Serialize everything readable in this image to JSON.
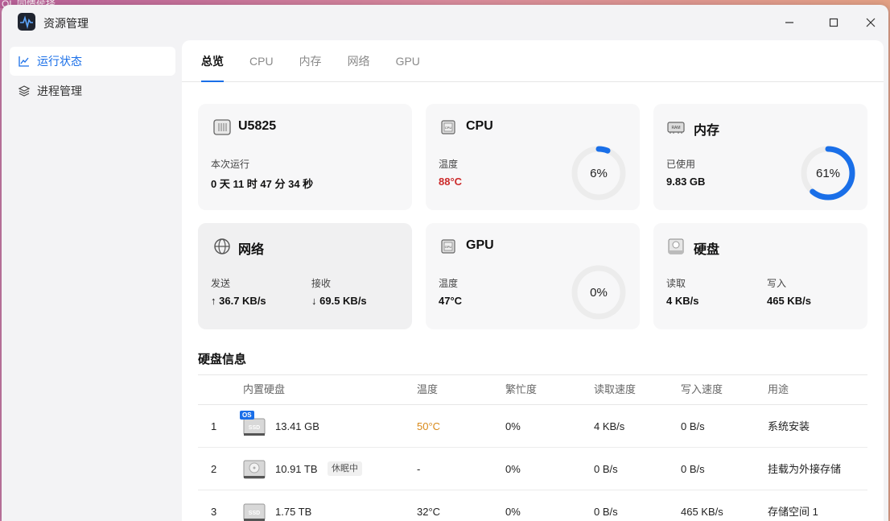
{
  "desktop": {
    "label": "OL 同情侯择"
  },
  "window": {
    "title": "资源管理"
  },
  "sidebar": {
    "items": [
      {
        "label": "运行状态",
        "icon": "line-chart-icon",
        "active": true
      },
      {
        "label": "进程管理",
        "icon": "layers-icon",
        "active": false
      }
    ]
  },
  "tabs": [
    {
      "label": "总览",
      "active": true
    },
    {
      "label": "CPU",
      "active": false
    },
    {
      "label": "内存",
      "active": false
    },
    {
      "label": "网络",
      "active": false
    },
    {
      "label": "GPU",
      "active": false
    }
  ],
  "cards": {
    "device": {
      "title": "U5825",
      "uptime_label": "本次运行",
      "uptime_value": "0 天 11 时 47 分 34 秒"
    },
    "cpu": {
      "title": "CPU",
      "temp_label": "温度",
      "temp_value": "88°C",
      "usage": "6%",
      "usage_fraction": 0.06
    },
    "memory": {
      "title": "内存",
      "used_label": "已使用",
      "used_value": "9.83 GB",
      "usage": "61%",
      "usage_fraction": 0.61
    },
    "network": {
      "title": "网络",
      "send_label": "发送",
      "send_value": "36.7 KB/s",
      "recv_label": "接收",
      "recv_value": "69.5 KB/s"
    },
    "gpu": {
      "title": "GPU",
      "temp_label": "温度",
      "temp_value": "47°C",
      "usage": "0%",
      "usage_fraction": 0
    },
    "disk": {
      "title": "硬盘",
      "read_label": "读取",
      "read_value": "4 KB/s",
      "write_label": "写入",
      "write_value": "465 KB/s"
    }
  },
  "colors": {
    "accent": "#1a6fe8",
    "hot_temp": "#cc2b2b",
    "warm_temp": "#d98a1a"
  },
  "disk_section": {
    "title": "硬盘信息",
    "headers": [
      "内置硬盘",
      "温度",
      "繁忙度",
      "读取速度",
      "写入速度",
      "用途"
    ],
    "rows": [
      {
        "index": "1",
        "os_badge": "OS",
        "icon": "ssd-icon",
        "size": "13.41 GB",
        "badge": "",
        "temp": "50°C",
        "busy": "0%",
        "read": "4 KB/s",
        "write": "0 B/s",
        "usage": "系统安装"
      },
      {
        "index": "2",
        "os_badge": "",
        "icon": "hdd-icon",
        "size": "10.91 TB",
        "badge": "休眠中",
        "temp": "-",
        "busy": "0%",
        "read": "0 B/s",
        "write": "0 B/s",
        "usage": "挂载为外接存储"
      },
      {
        "index": "3",
        "os_badge": "",
        "icon": "ssd-icon",
        "size": "1.75 TB",
        "badge": "",
        "temp": "32°C",
        "busy": "0%",
        "read": "0 B/s",
        "write": "465 KB/s",
        "usage": "存储空间 1"
      }
    ]
  }
}
